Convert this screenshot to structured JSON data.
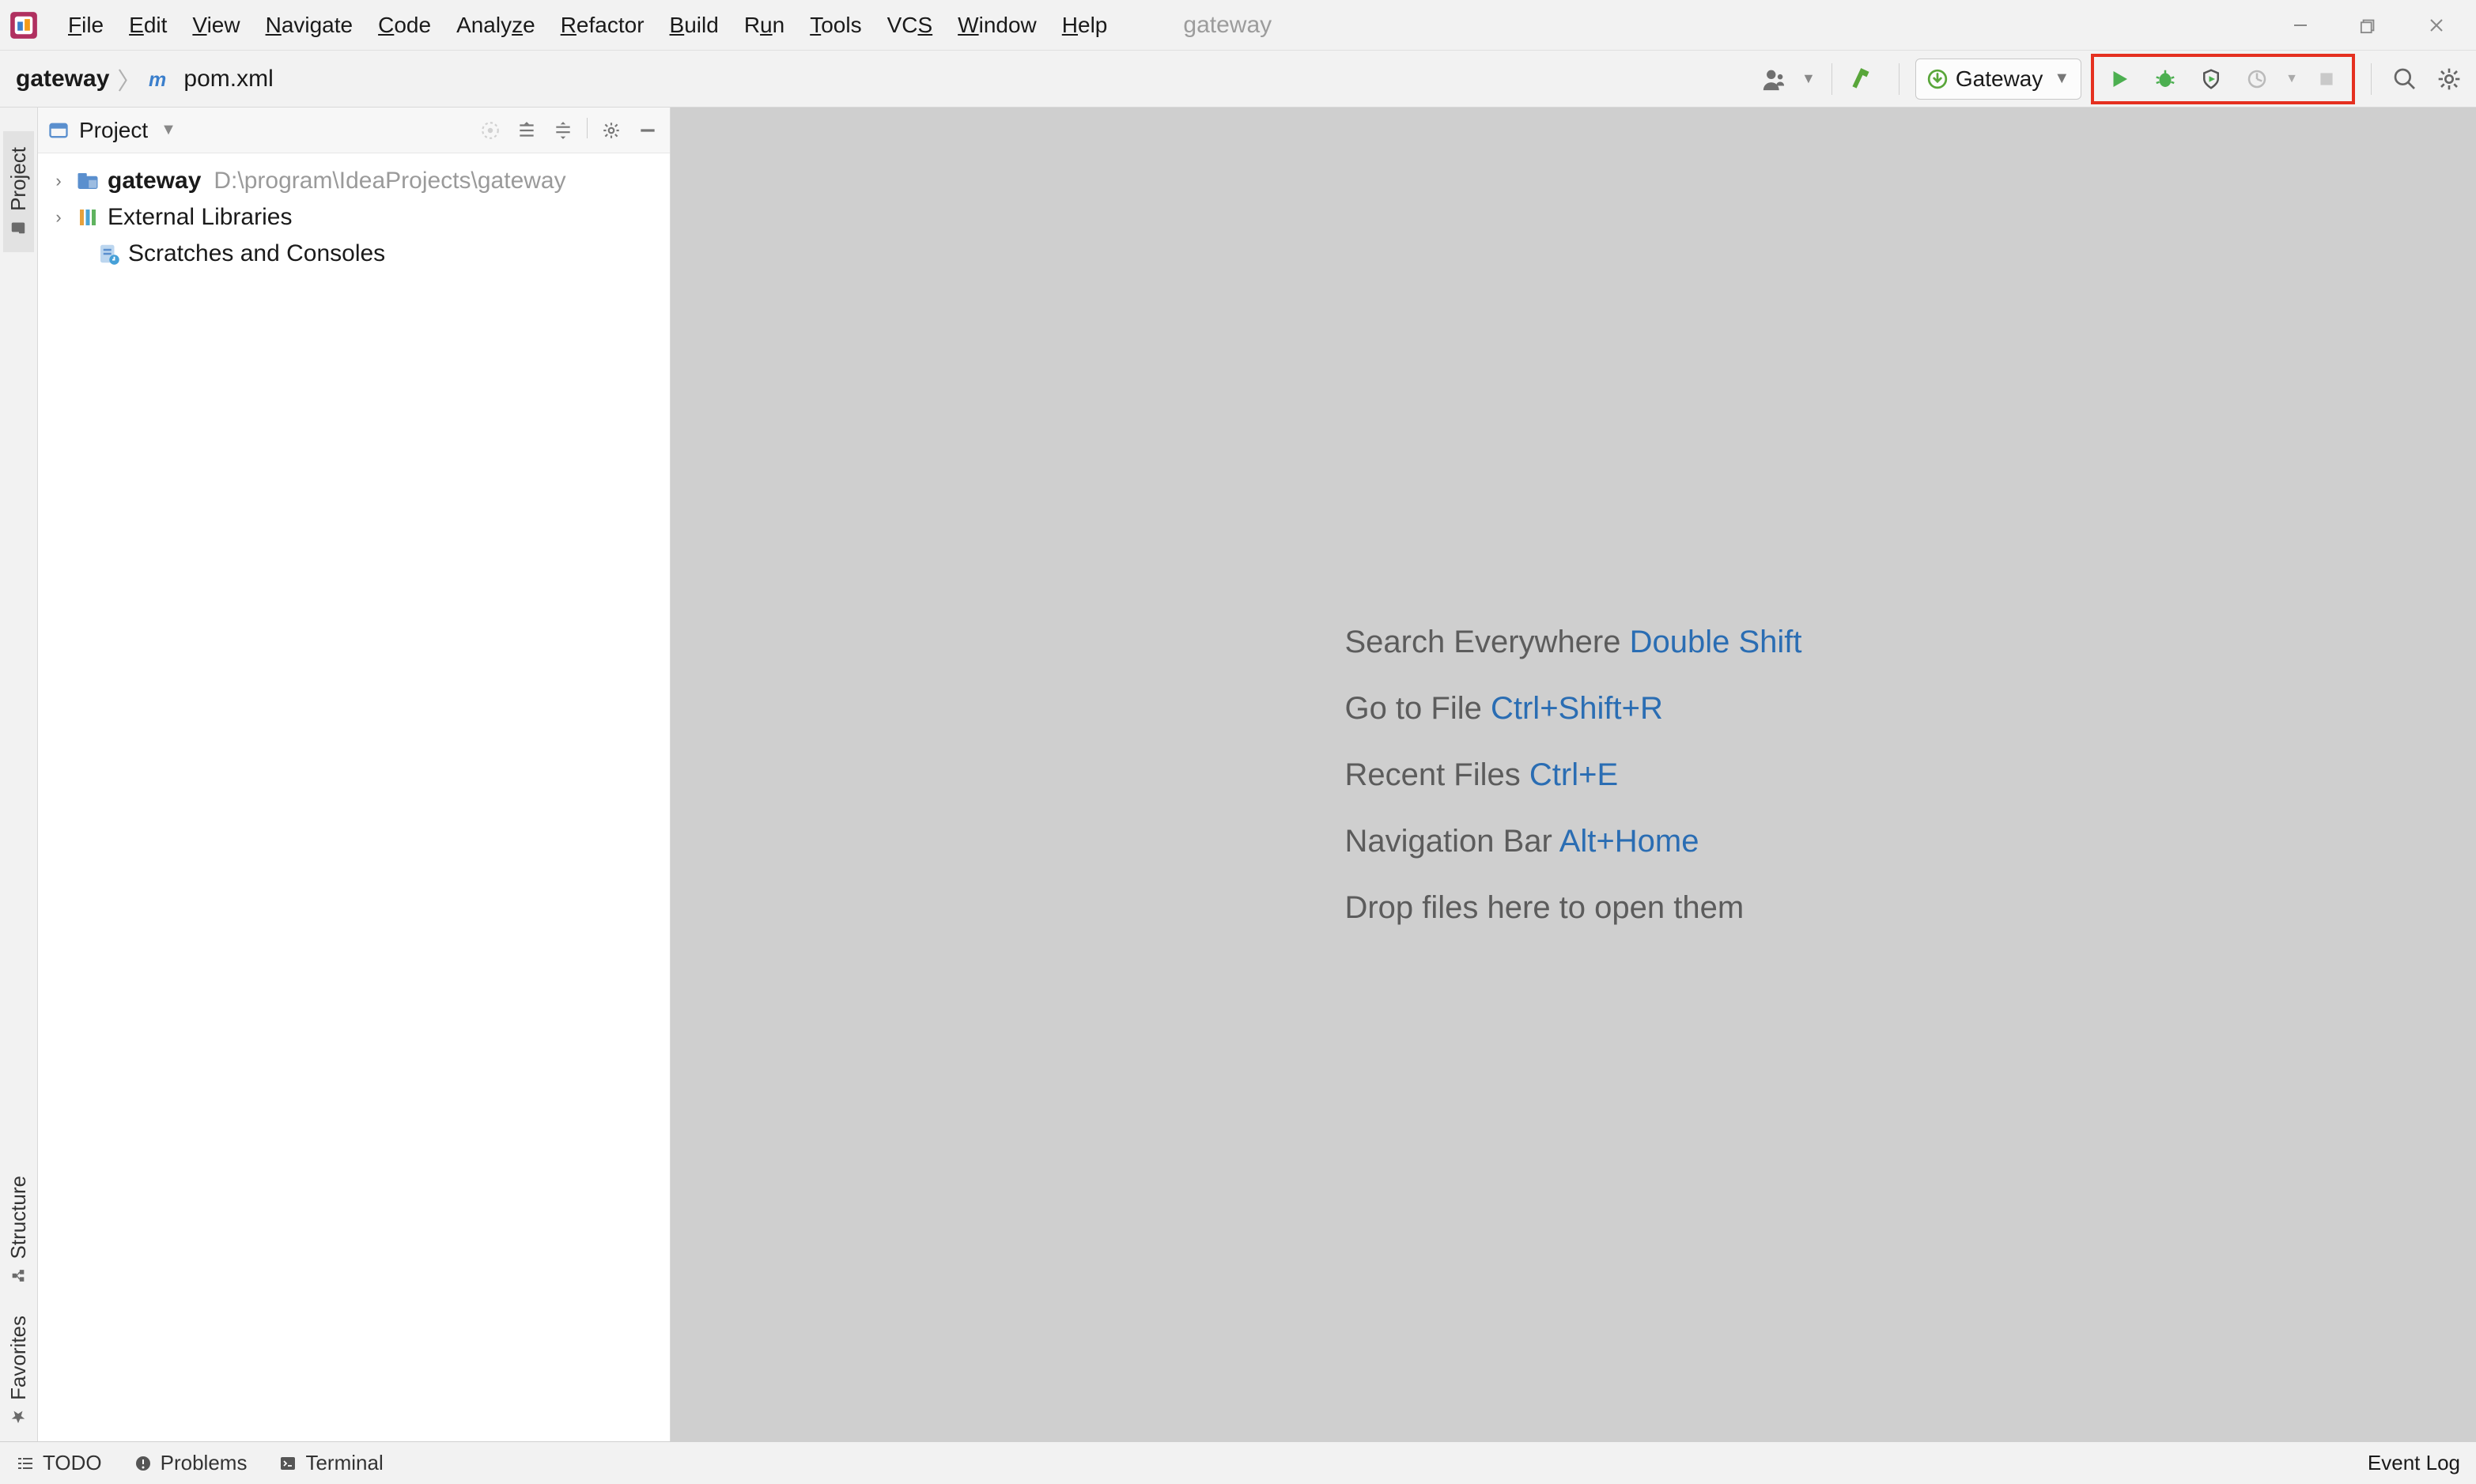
{
  "window": {
    "project_title": "gateway"
  },
  "menu": {
    "items": [
      {
        "label": "File",
        "mn": "F"
      },
      {
        "label": "Edit",
        "mn": "E"
      },
      {
        "label": "View",
        "mn": "V"
      },
      {
        "label": "Navigate",
        "mn": "N"
      },
      {
        "label": "Code",
        "mn": "C"
      },
      {
        "label": "Analyze"
      },
      {
        "label": "Refactor",
        "mn": "R"
      },
      {
        "label": "Build",
        "mn": "B"
      },
      {
        "label": "Run",
        "mn": "u",
        "pre": "R"
      },
      {
        "label": "Tools",
        "mn": "T"
      },
      {
        "label": "VCS",
        "mn": "S",
        "pre": "VC"
      },
      {
        "label": "Window",
        "mn": "W"
      },
      {
        "label": "Help",
        "mn": "H"
      }
    ]
  },
  "breadcrumb": {
    "project": "gateway",
    "file": "pom.xml"
  },
  "run_config": {
    "name": "Gateway"
  },
  "side_tabs": {
    "project": "Project",
    "structure": "Structure",
    "favorites": "Favorites"
  },
  "project_panel": {
    "title": "Project",
    "tree": {
      "root": {
        "name": "gateway",
        "path": "D:\\program\\IdeaProjects\\gateway"
      },
      "ext_lib": "External Libraries",
      "scratches": "Scratches and Consoles"
    }
  },
  "editor_hints": [
    {
      "label": "Search Everywhere",
      "shortcut": "Double Shift"
    },
    {
      "label": "Go to File",
      "shortcut": "Ctrl+Shift+R"
    },
    {
      "label": "Recent Files",
      "shortcut": "Ctrl+E"
    },
    {
      "label": "Navigation Bar",
      "shortcut": "Alt+Home"
    },
    {
      "label": "Drop files here to open them",
      "shortcut": ""
    }
  ],
  "bottom": {
    "todo": "TODO",
    "problems": "Problems",
    "terminal": "Terminal",
    "event_log": "Event Log"
  }
}
